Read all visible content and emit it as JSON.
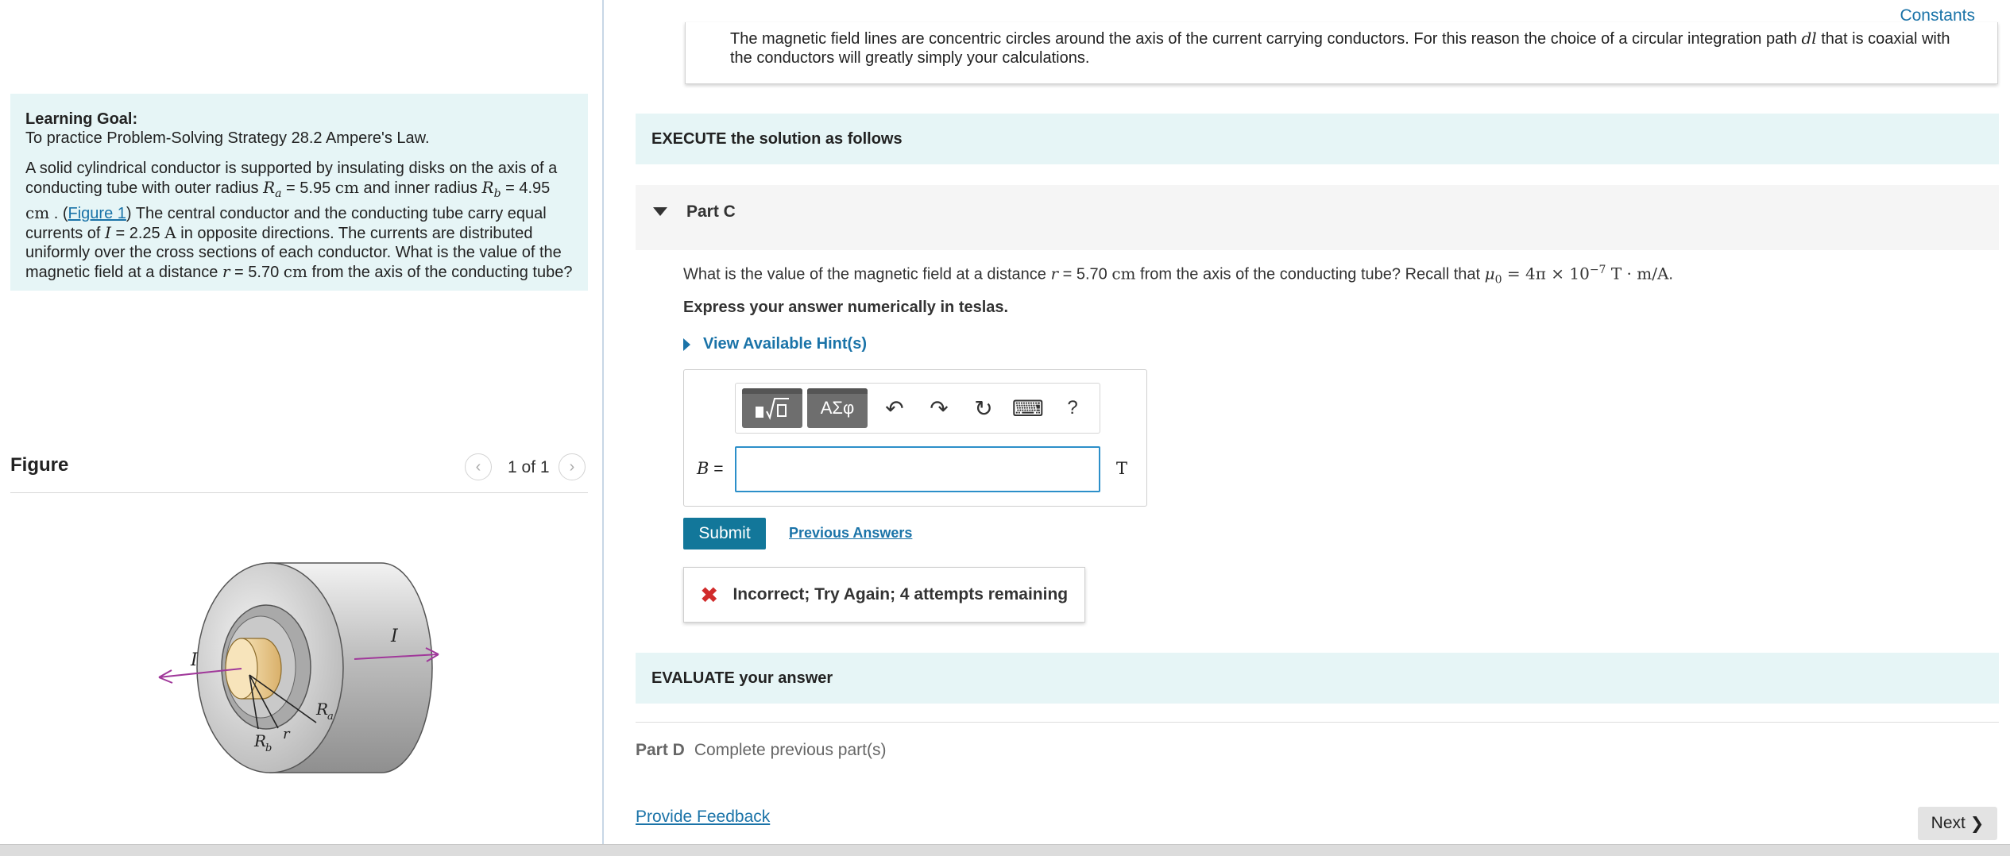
{
  "left": {
    "goal_title": "Learning Goal:",
    "goal_subtitle": "To practice Problem-Solving Strategy 28.2 Ampere's Law.",
    "problem": {
      "t1": "A solid cylindrical conductor is supported by insulating disks on the axis of a conducting tube with outer radius ",
      "Ra_sym": "R",
      "Ra_sub": "a",
      "t2": " = 5.95 ",
      "unit_cm1": "cm",
      "t3": " and inner radius ",
      "Rb_sym": "R",
      "Rb_sub": "b",
      "t4": " = 4.95 ",
      "unit_cm2": "cm",
      "t5": " . (",
      "figure_link": "Figure 1",
      "t6": ") The central conductor and the conducting tube carry equal currents of ",
      "I_sym": "I",
      "t7": " = 2.25 ",
      "unit_A": "A",
      "t8": " in opposite directions. The currents are distributed uniformly over the cross sections of each conductor. What is the value of the magnetic field at a distance ",
      "r_sym": "r",
      "t9": " = 5.70 ",
      "unit_cm3": "cm",
      "t10": " from the axis of the conducting tube?"
    },
    "figure": {
      "title": "Figure",
      "pager": "1 of 1",
      "label_I_left": "I",
      "label_I_right": "I",
      "label_Ra": "R",
      "label_Ra_sub": "a",
      "label_Rb": "R",
      "label_Rb_sub": "b",
      "label_r": "r"
    }
  },
  "right": {
    "constants_link": "Constants",
    "hint_text_1": "The magnetic field lines are concentric circles around the axis of the current carrying conductors. For this reason the choice of a circular integration path ",
    "hint_dl": "dl",
    "hint_text_2": " that is coaxial with the conductors will greatly simply your calculations.",
    "execute_label": "EXECUTE the solution as follows",
    "part_c_title": "Part C",
    "question_1": "What is the value of the magnetic field at a distance ",
    "question_r": "r",
    "question_2": " = 5.70 ",
    "question_cm": "cm",
    "question_3": " from the axis of the conducting tube? Recall that ",
    "question_mu": "μ",
    "question_mu_sub": "0",
    "question_eq": " = 4π × 10",
    "question_exp": "−7",
    "question_units": " T · m/A",
    "question_end": ".",
    "instruction": "Express your answer numerically in teslas.",
    "hints_toggle": "View Available Hint(s)",
    "toolbar": {
      "templates_icon": "templates-icon",
      "symbols_label": "ΑΣφ",
      "undo_icon": "↶",
      "redo_icon": "↷",
      "reset_icon": "↻",
      "keyboard_icon": "⌨",
      "help_icon": "?"
    },
    "answer": {
      "variable": "B",
      "equals": " =",
      "value": "",
      "unit": "T"
    },
    "submit_label": "Submit",
    "previous_answers": "Previous Answers",
    "feedback": "Incorrect; Try Again; 4 attempts remaining",
    "evaluate_label": "EVALUATE your answer",
    "part_d_title": "Part D",
    "part_d_status": "Complete previous part(s)",
    "provide_feedback": "Provide Feedback",
    "next_label": "Next",
    "next_chevron": "❯"
  },
  "colors": {
    "accent_teal": "#12779a",
    "band_bg": "#e6f5f6",
    "link_blue": "#1a73a8",
    "error_red": "#d12b2b",
    "current_arrow": "#a0389a"
  }
}
